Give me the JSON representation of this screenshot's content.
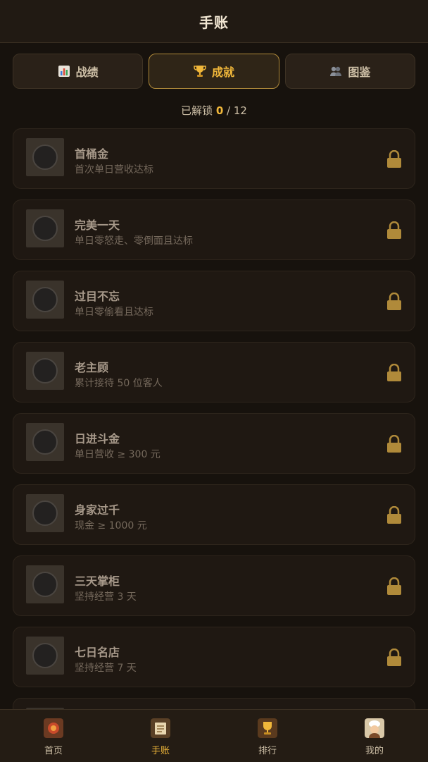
{
  "header": {
    "title": "手账"
  },
  "tabs": [
    {
      "label": "战绩",
      "icon": "bar-chart-icon",
      "active": false
    },
    {
      "label": "成就",
      "icon": "trophy-icon",
      "active": true
    },
    {
      "label": "图鉴",
      "icon": "people-icon",
      "active": false
    }
  ],
  "progress": {
    "prefix": "已解锁",
    "unlocked": "0",
    "separator": "/",
    "total": "12"
  },
  "achievements": [
    {
      "name": "首桶金",
      "desc": "首次单日营收达标",
      "icon": "money-bag-icon",
      "locked": true
    },
    {
      "name": "完美一天",
      "desc": "单日零怒走、零倒面且达标",
      "icon": "sun-icon",
      "locked": true
    },
    {
      "name": "过目不忘",
      "desc": "单日零偷看且达标",
      "icon": "eye-icon",
      "locked": true
    },
    {
      "name": "老主顾",
      "desc": "累计接待 50 位客人",
      "icon": "handshake-icon",
      "locked": true
    },
    {
      "name": "日进斗金",
      "desc": "单日营收 ≥ 300 元",
      "icon": "treasure-icon",
      "locked": true
    },
    {
      "name": "身家过千",
      "desc": "现金 ≥ 1000 元",
      "icon": "piggy-bank-icon",
      "locked": true
    },
    {
      "name": "三天掌柜",
      "desc": "坚持经营 3 天",
      "icon": "calendar-icon",
      "locked": true
    },
    {
      "name": "七日名店",
      "desc": "坚持经营 7 天",
      "icon": "scroll-icon",
      "locked": true
    },
    {
      "name": "",
      "desc": "",
      "icon": "medal-icon",
      "locked": true
    }
  ],
  "nav": [
    {
      "label": "首页",
      "icon": "home-icon",
      "active": false
    },
    {
      "label": "手账",
      "icon": "notebook-icon",
      "active": true
    },
    {
      "label": "排行",
      "icon": "trophy-icon",
      "active": false
    },
    {
      "label": "我的",
      "icon": "chef-avatar-icon",
      "active": false
    }
  ],
  "colors": {
    "accent": "#f0b73a",
    "background": "#17120d",
    "lock": "#b08a3a"
  }
}
